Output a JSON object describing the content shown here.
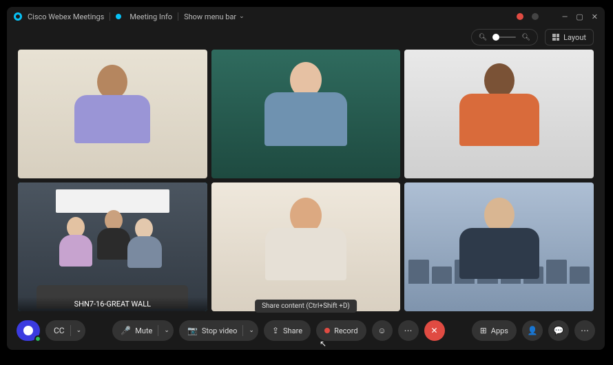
{
  "titlebar": {
    "app_name": "Cisco Webex Meetings",
    "meeting_info": "Meeting Info",
    "show_menu_bar": "Show menu bar"
  },
  "toolbar": {
    "layout_label": "Layout"
  },
  "tiles": [
    {
      "label": "",
      "active": false
    },
    {
      "label": "",
      "active": false
    },
    {
      "label": "",
      "active": false
    },
    {
      "label": "SHN7-16-GREAT WALL",
      "active": true
    },
    {
      "label": "",
      "active": false
    },
    {
      "label": "",
      "active": false
    }
  ],
  "tooltip": "Share content (Ctrl+Shift +D)",
  "controls": {
    "mute": "Mute",
    "stop_video": "Stop video",
    "share": "Share",
    "record": "Record",
    "apps": "Apps"
  }
}
